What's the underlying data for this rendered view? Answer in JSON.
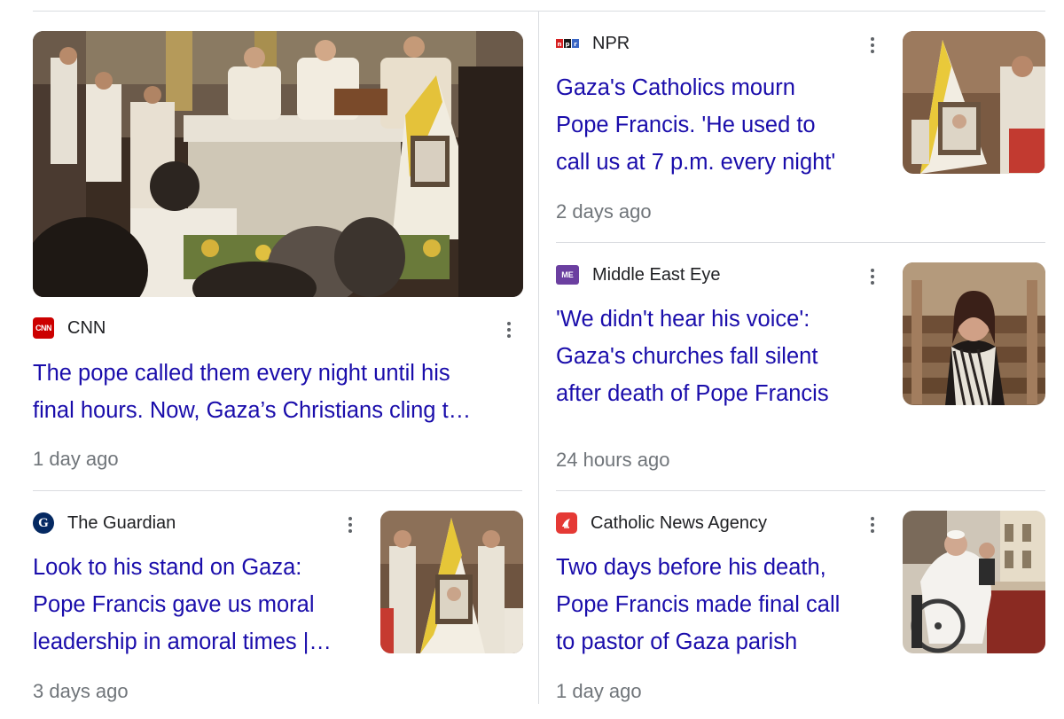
{
  "cards": [
    {
      "source": "CNN",
      "logo": "cnn-logo",
      "headline_lines": [
        "The pope called them every night until his",
        "final hours. Now, Gaza’s Christians cling t…"
      ],
      "time": "1 day ago"
    },
    {
      "source": "NPR",
      "logo": "npr-logo",
      "headline_lines": [
        "Gaza's Catholics mourn",
        "Pope Francis. 'He used to",
        "call us at 7 p.m. every night'"
      ],
      "time": "2 days ago"
    },
    {
      "source": "Middle East Eye",
      "logo": "middle-east-eye-logo",
      "headline_lines": [
        "'We didn't hear his voice':",
        "Gaza's churches fall silent",
        "after death of Pope Francis"
      ],
      "time": "24 hours ago"
    },
    {
      "source": "The Guardian",
      "logo": "guardian-logo",
      "headline_lines": [
        "Look to his stand on Gaza:",
        "Pope Francis gave us moral",
        "leadership in amoral times |…"
      ],
      "time": "3 days ago"
    },
    {
      "source": "Catholic News Agency",
      "logo": "catholic-news-agency-logo",
      "headline_lines": [
        "Two days before his death,",
        "Pope Francis made final call",
        "to pastor of Gaza parish"
      ],
      "time": "1 day ago"
    }
  ],
  "colors": {
    "headline": "#1a0dab",
    "meta": "#70757a",
    "cnn": "#cc0000",
    "npr_red": "#d62021",
    "npr_blue": "#3a66c4",
    "mee": "#6b3fa0",
    "cna": "#e53935"
  }
}
